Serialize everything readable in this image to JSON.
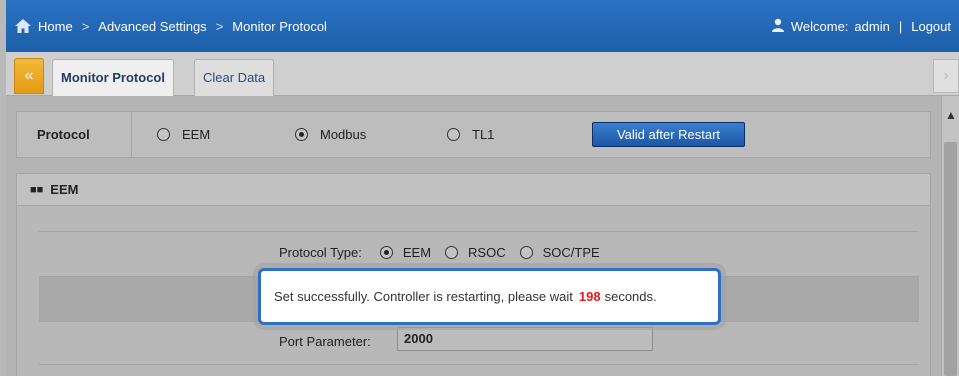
{
  "header": {
    "breadcrumbs": [
      "Home",
      "Advanced Settings",
      "Monitor Protocol"
    ],
    "separator": ">",
    "welcome_label": "Welcome:",
    "username": "admin",
    "pipe": "|",
    "logout_label": "Logout"
  },
  "tabs": {
    "collapse_icon": "double-chevron-left-icon",
    "items": [
      {
        "label": "Monitor Protocol",
        "active": true
      },
      {
        "label": "Clear Data",
        "active": false
      }
    ],
    "next_icon": "chevron-right-icon"
  },
  "protocol": {
    "label": "Protocol",
    "options": [
      {
        "label": "EEM",
        "selected": false
      },
      {
        "label": "Modbus",
        "selected": true
      },
      {
        "label": "TL1",
        "selected": false
      }
    ],
    "button_label": "Valid after Restart"
  },
  "eem": {
    "title": "EEM",
    "protocol_type_label": "Protocol Type:",
    "protocol_type_options": [
      {
        "label": "EEM",
        "selected": true
      },
      {
        "label": "RSOC",
        "selected": false
      },
      {
        "label": "SOC/TPE",
        "selected": false
      }
    ],
    "port_parameter_label": "Port Parameter:",
    "port_parameter_value": "2000"
  },
  "modal": {
    "message_prefix": "Set successfully. Controller is restarting, please wait",
    "countdown": "198",
    "message_suffix": "seconds."
  },
  "colors": {
    "header_blue": "#2a72c2",
    "accent_orange": "#e49a16",
    "countdown_red": "#e21b1b",
    "modal_border": "#2f6fc6"
  }
}
